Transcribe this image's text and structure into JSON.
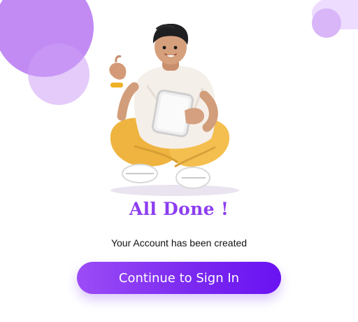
{
  "screen": {
    "title": "All Done !",
    "subtitle": "Your Account has been created",
    "cta_label": "Continue to Sign In"
  },
  "illustration": {
    "icon": "person-with-tablet-illustration"
  },
  "colors": {
    "accent": "#8d3ef0",
    "button_gradient_start": "#9c4cf6",
    "button_gradient_end": "#6a12f2",
    "blob_primary": "#c18bf3",
    "blob_light": "#eddcfd"
  }
}
